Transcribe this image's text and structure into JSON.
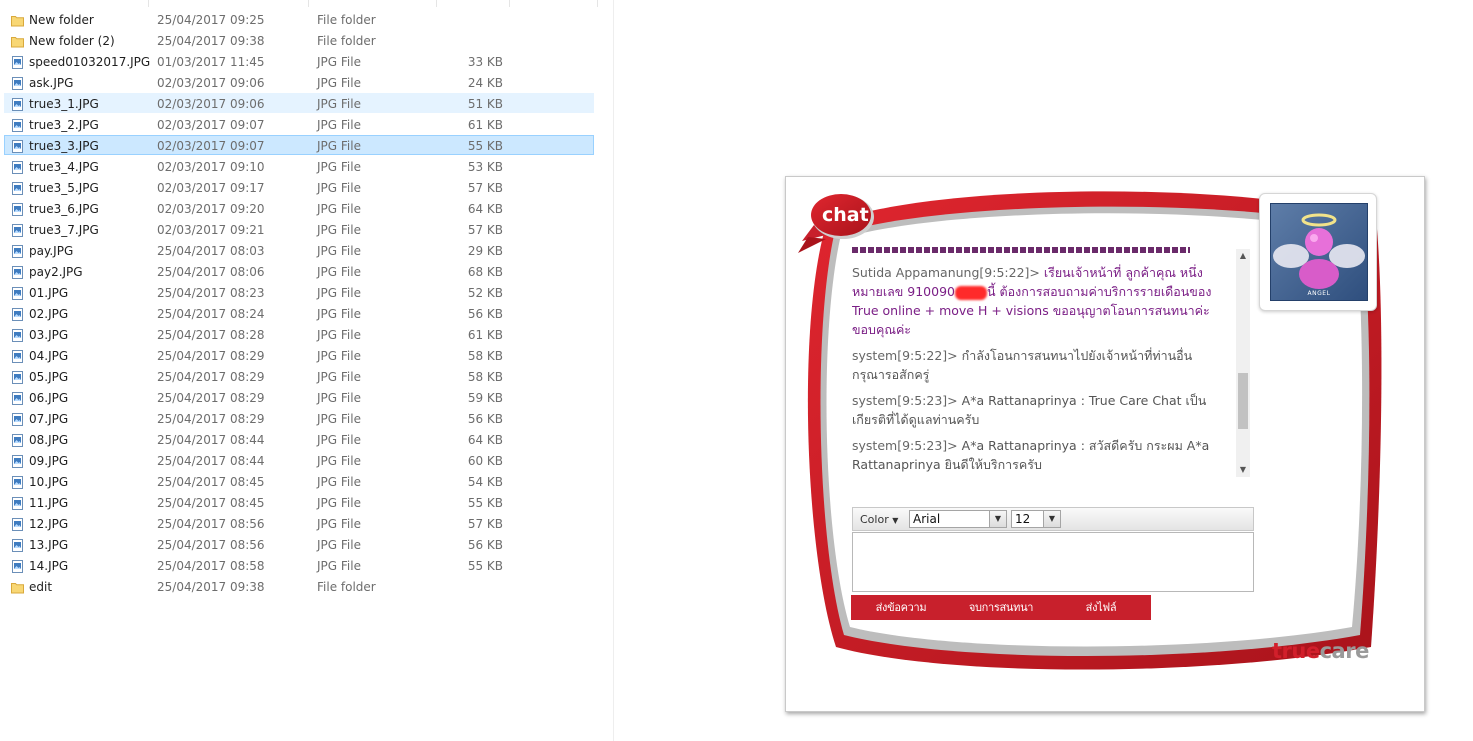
{
  "explorer": {
    "files": [
      {
        "name": "New folder",
        "date": "25/04/2017 09:25",
        "type": "File folder",
        "size": "",
        "icon": "folder-icon",
        "state": ""
      },
      {
        "name": "New folder (2)",
        "date": "25/04/2017 09:38",
        "type": "File folder",
        "size": "",
        "icon": "folder-icon",
        "state": ""
      },
      {
        "name": "speed01032017.JPG",
        "date": "01/03/2017 11:45",
        "type": "JPG File",
        "size": "33 KB",
        "icon": "image-file-icon",
        "state": ""
      },
      {
        "name": "ask.JPG",
        "date": "02/03/2017 09:06",
        "type": "JPG File",
        "size": "24 KB",
        "icon": "image-file-icon",
        "state": ""
      },
      {
        "name": "true3_1.JPG",
        "date": "02/03/2017 09:06",
        "type": "JPG File",
        "size": "51 KB",
        "icon": "image-file-icon",
        "state": "hover"
      },
      {
        "name": "true3_2.JPG",
        "date": "02/03/2017 09:07",
        "type": "JPG File",
        "size": "61 KB",
        "icon": "image-file-icon",
        "state": ""
      },
      {
        "name": "true3_3.JPG",
        "date": "02/03/2017 09:07",
        "type": "JPG File",
        "size": "55 KB",
        "icon": "image-file-icon",
        "state": "selected"
      },
      {
        "name": "true3_4.JPG",
        "date": "02/03/2017 09:10",
        "type": "JPG File",
        "size": "53 KB",
        "icon": "image-file-icon",
        "state": ""
      },
      {
        "name": "true3_5.JPG",
        "date": "02/03/2017 09:17",
        "type": "JPG File",
        "size": "57 KB",
        "icon": "image-file-icon",
        "state": ""
      },
      {
        "name": "true3_6.JPG",
        "date": "02/03/2017 09:20",
        "type": "JPG File",
        "size": "64 KB",
        "icon": "image-file-icon",
        "state": ""
      },
      {
        "name": "true3_7.JPG",
        "date": "02/03/2017 09:21",
        "type": "JPG File",
        "size": "57 KB",
        "icon": "image-file-icon",
        "state": ""
      },
      {
        "name": "pay.JPG",
        "date": "25/04/2017 08:03",
        "type": "JPG File",
        "size": "29 KB",
        "icon": "image-file-icon",
        "state": ""
      },
      {
        "name": "pay2.JPG",
        "date": "25/04/2017 08:06",
        "type": "JPG File",
        "size": "68 KB",
        "icon": "image-file-icon",
        "state": ""
      },
      {
        "name": "01.JPG",
        "date": "25/04/2017 08:23",
        "type": "JPG File",
        "size": "52 KB",
        "icon": "image-file-icon",
        "state": ""
      },
      {
        "name": "02.JPG",
        "date": "25/04/2017 08:24",
        "type": "JPG File",
        "size": "56 KB",
        "icon": "image-file-icon",
        "state": ""
      },
      {
        "name": "03.JPG",
        "date": "25/04/2017 08:28",
        "type": "JPG File",
        "size": "61 KB",
        "icon": "image-file-icon",
        "state": ""
      },
      {
        "name": "04.JPG",
        "date": "25/04/2017 08:29",
        "type": "JPG File",
        "size": "58 KB",
        "icon": "image-file-icon",
        "state": ""
      },
      {
        "name": "05.JPG",
        "date": "25/04/2017 08:29",
        "type": "JPG File",
        "size": "58 KB",
        "icon": "image-file-icon",
        "state": ""
      },
      {
        "name": "06.JPG",
        "date": "25/04/2017 08:29",
        "type": "JPG File",
        "size": "59 KB",
        "icon": "image-file-icon",
        "state": ""
      },
      {
        "name": "07.JPG",
        "date": "25/04/2017 08:29",
        "type": "JPG File",
        "size": "56 KB",
        "icon": "image-file-icon",
        "state": ""
      },
      {
        "name": "08.JPG",
        "date": "25/04/2017 08:44",
        "type": "JPG File",
        "size": "64 KB",
        "icon": "image-file-icon",
        "state": ""
      },
      {
        "name": "09.JPG",
        "date": "25/04/2017 08:44",
        "type": "JPG File",
        "size": "60 KB",
        "icon": "image-file-icon",
        "state": ""
      },
      {
        "name": "10.JPG",
        "date": "25/04/2017 08:45",
        "type": "JPG File",
        "size": "54 KB",
        "icon": "image-file-icon",
        "state": ""
      },
      {
        "name": "11.JPG",
        "date": "25/04/2017 08:45",
        "type": "JPG File",
        "size": "55 KB",
        "icon": "image-file-icon",
        "state": ""
      },
      {
        "name": "12.JPG",
        "date": "25/04/2017 08:56",
        "type": "JPG File",
        "size": "57 KB",
        "icon": "image-file-icon",
        "state": ""
      },
      {
        "name": "13.JPG",
        "date": "25/04/2017 08:56",
        "type": "JPG File",
        "size": "56 KB",
        "icon": "image-file-icon",
        "state": ""
      },
      {
        "name": "14.JPG",
        "date": "25/04/2017 08:58",
        "type": "JPG File",
        "size": "55 KB",
        "icon": "image-file-icon",
        "state": ""
      },
      {
        "name": "edit",
        "date": "25/04/2017 09:38",
        "type": "File folder",
        "size": "",
        "icon": "folder-icon",
        "state": ""
      }
    ]
  },
  "chat": {
    "badge_label": "chat",
    "messages": {
      "m1": {
        "sender": "Sutida Appamanung[9:5:22]>",
        "text_a": "เรียนเจ้าหน้าที่ ลูกค้าคุณ หนึ่ง หมายเลข 910090",
        "text_b": "นี้ ต้องการสอบถามค่าบริการรายเดือนของ True online + move H + visions ขออนุญาตโอนการสนทนาค่ะ ขอบคุณค่ะ"
      },
      "m2": {
        "sender": "system[9:5:22]>",
        "text": "กำลังโอนการสนทนาไปยังเจ้าหน้าที่ท่านอื่น กรุณารอสักครู่"
      },
      "m3": {
        "sender": "system[9:5:23]>",
        "text": "A*a Rattanaprinya : True Care Chat เป็นเกียรติที่ได้ดูแลท่านครับ"
      },
      "m4": {
        "sender": "system[9:5:23]>",
        "text": "A*a Rattanaprinya : สวัสดีครับ กระผม A*a Rattanaprinya ยินดีให้บริการครับ"
      }
    },
    "toolbar": {
      "color_label": "Color",
      "font_value": "Arial",
      "size_value": "12"
    },
    "input": {
      "value": ""
    },
    "actions": {
      "send_label": "ส่งข้อความ",
      "end_label": "จบการสนทนา",
      "file_label": "ส่งไฟล์"
    },
    "avatar": {
      "caption": "ANGEL"
    },
    "brand": {
      "part1": "true",
      "part2": "care"
    },
    "colors": {
      "accent": "#c8202c",
      "purple_text": "#7b1f86"
    }
  }
}
